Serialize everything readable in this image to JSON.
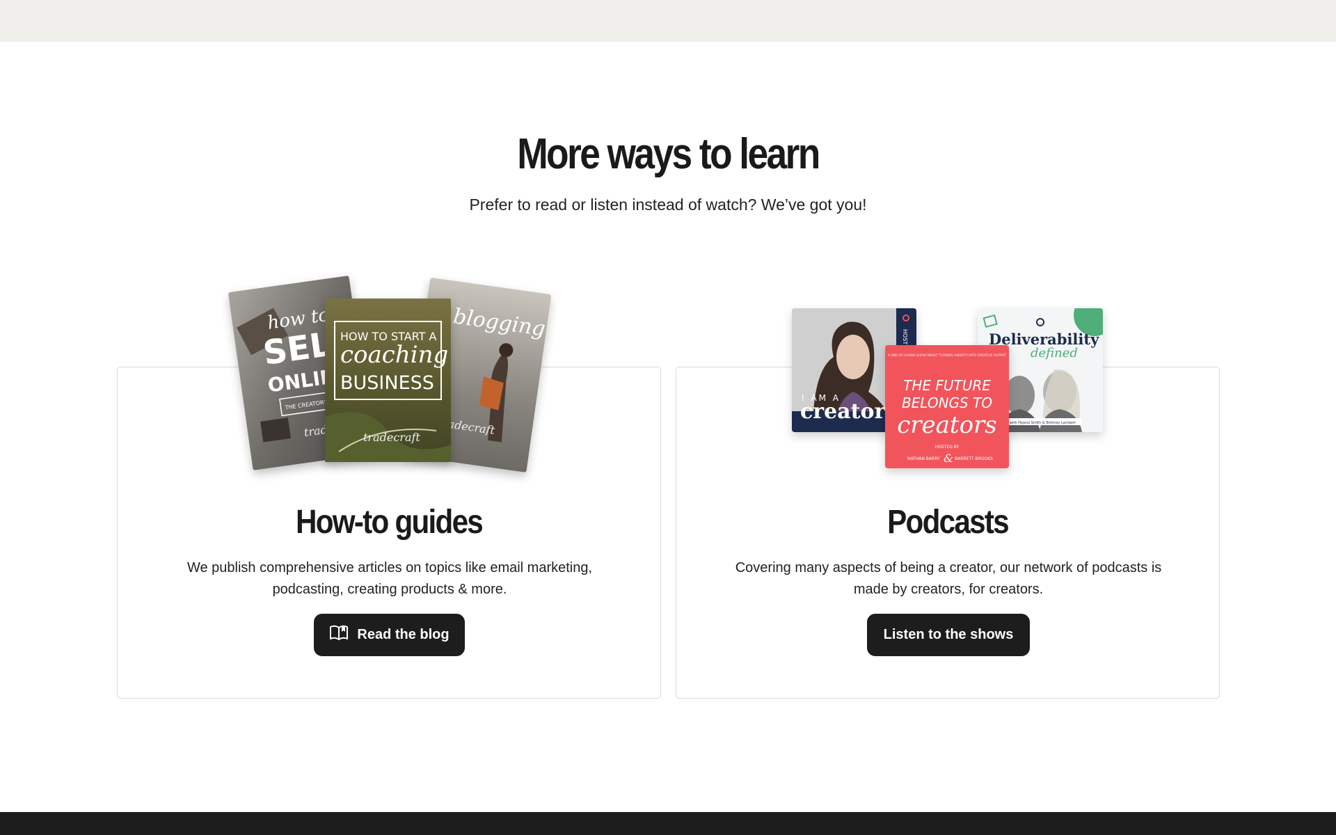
{
  "section": {
    "title": "More ways to learn",
    "subtitle": "Prefer to read or listen instead of watch? We’ve got you!"
  },
  "guides": {
    "title": "How-to guides",
    "description": "We publish comprehensive articles on topics like email marketing, podcasting, creating products & more.",
    "button_label": "Read the blog",
    "button_icon": "open-book-icon",
    "covers": {
      "left_line1": "how to",
      "left_line2": "SELL",
      "left_line3": "ONLINE",
      "left_tag": "THE CREATOR'S MAKING",
      "left_brand": "tradecraft",
      "center_line1": "HOW TO",
      "center_line2": "START A",
      "center_line3": "coaching",
      "center_line4": "BUSINESS",
      "center_brand": "tradecraft",
      "right_line1": "blogging",
      "right_brand": "tradecraft"
    }
  },
  "podcasts": {
    "title": "Podcasts",
    "description": "Covering many aspects of being a creator, our network of podcasts is made by creators, for creators.",
    "button_label": "Listen to the shows",
    "art": {
      "creator_small": "I AM A",
      "creator_big": "creator.",
      "creator_side": "HOSTE",
      "future_top": "A ONE-OF-A-KIND SHOW ABOUT TURNING ANXIETY INTO CREATIVE OUTPUT",
      "future_line1": "THE FUTURE",
      "future_line2": "BELONGS TO",
      "future_line3": "creators",
      "future_hosted": "HOSTED BY",
      "future_host1": "NATHAN BARRY",
      "future_host2": "BARRETT BROOKS",
      "deliver_line1": "Deliverability",
      "deliver_line2": "defined",
      "deliver_hosts": "with Hyaniz Smith & Brittney Lambert"
    }
  },
  "colors": {
    "top_strip": "#f0efeb",
    "footer": "#1d1d1d",
    "button": "#1d1d1d",
    "podcast_red": "#f2545b",
    "podcast_navy": "#1d2b4f",
    "deliver_green": "#4fae7a"
  }
}
